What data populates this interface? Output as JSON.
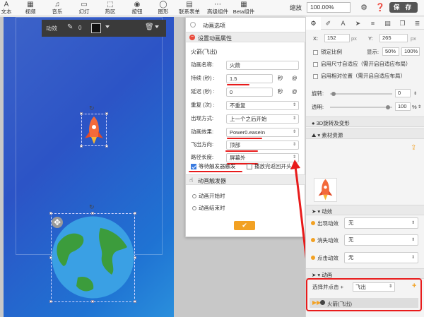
{
  "toolbar": {
    "tools": [
      {
        "name": "text",
        "icon": "A",
        "label": "文本"
      },
      {
        "name": "video",
        "icon": "▦",
        "label": "视频"
      },
      {
        "name": "music",
        "icon": "♫",
        "label": "音乐"
      },
      {
        "name": "slideshow",
        "icon": "▭",
        "label": "幻灯"
      },
      {
        "name": "hotspot",
        "icon": "⬚",
        "label": "热区"
      },
      {
        "name": "button",
        "icon": "◉",
        "label": "按钮"
      },
      {
        "name": "shape",
        "icon": "◯",
        "label": "图形"
      },
      {
        "name": "contact-form",
        "icon": "▤",
        "label": "联系表单"
      },
      {
        "name": "advanced",
        "icon": "⋯",
        "label": "高级组件"
      },
      {
        "name": "beta",
        "icon": "▦",
        "label": "Beta组件"
      }
    ],
    "zoom_label": "缩放",
    "zoom_value": "100.00%",
    "save_label": "保 存"
  },
  "float_bar": {
    "title": "动效",
    "stroke_value": "0"
  },
  "dialog": {
    "title": "动画选项",
    "section_props": "设置动画属性",
    "element_name": "火箭(飞出)",
    "fields": {
      "name_label": "动画名称:",
      "name_value": "火箭",
      "duration_label": "持续 (秒) :",
      "duration_value": "1.5",
      "duration_unit": "秒",
      "delay_label": "延迟 (秒) :",
      "delay_value": "0",
      "delay_unit": "秒",
      "repeat_label": "重复 (次) :",
      "repeat_value": "不重复",
      "appear_label": "出现方式:",
      "appear_value": "上一个之后开始",
      "effect_label": "动画效果:",
      "effect_value": "Power0.easeIn",
      "direction_label": "飞出方向:",
      "direction_value": "顶部",
      "path_label": "路径长度:",
      "path_value": "屏幕外"
    },
    "wait_trigger_label": "等待触发器触发",
    "loop_label": "播放完返回开头",
    "section_trigger": "动画触发器",
    "trigger_start": "动画开始时",
    "trigger_end": "动画结束时"
  },
  "right_panel": {
    "x_label": "X:",
    "x_value": "152",
    "y_label": "Y:",
    "y_value": "265",
    "px": "px",
    "lock_ratio": "锁定比例",
    "display_label": "显示:",
    "display_50": "50%",
    "display_100": "100%",
    "adaptive_size": "启用尺寸自适应（需开启自适应布局）",
    "relative_pos": "启用相对位置（需开启自适应布局）",
    "rotate_label": "旋转:",
    "rotate_value": "0",
    "opacity_label": "透明:",
    "opacity_value": "100",
    "percent": "%",
    "section_3d": "3D旋转及变形",
    "section_assets": "素材资源",
    "asset_name": "火箭",
    "section_effects": "动效",
    "appear_effect_label": "出现动效",
    "appear_effect_value": "无",
    "disappear_effect_label": "消失动效",
    "disappear_effect_value": "无",
    "click_effect_label": "点击动效",
    "click_effect_value": "无",
    "section_animation": "动画",
    "select_click_label": "选择并点击 +",
    "select_click_value": "飞出",
    "animation_item": "火箭(飞出)"
  }
}
